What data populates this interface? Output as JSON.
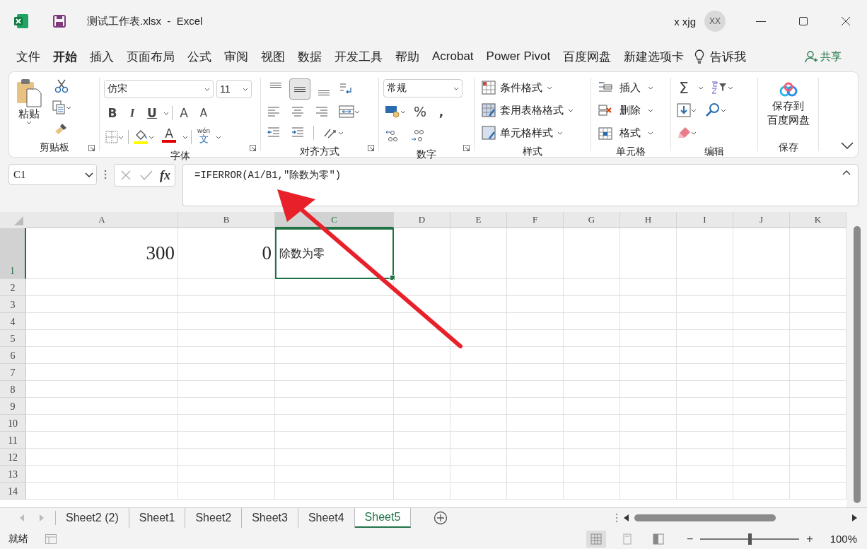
{
  "window": {
    "title": "测试工作表.xlsx  -  Excel",
    "user": "x xjg",
    "avatar": "XX"
  },
  "menu": [
    {
      "label": "文件",
      "selected": false
    },
    {
      "label": "开始",
      "selected": true
    },
    {
      "label": "插入",
      "selected": false
    },
    {
      "label": "页面布局",
      "selected": false
    },
    {
      "label": "公式",
      "selected": false
    },
    {
      "label": "审阅",
      "selected": false
    },
    {
      "label": "视图",
      "selected": false
    },
    {
      "label": "数据",
      "selected": false
    },
    {
      "label": "开发工具",
      "selected": false
    },
    {
      "label": "帮助",
      "selected": false
    },
    {
      "label": "Acrobat",
      "selected": false
    },
    {
      "label": "Power Pivot",
      "selected": false
    },
    {
      "label": "百度网盘",
      "selected": false
    },
    {
      "label": "新建选项卡",
      "selected": false
    }
  ],
  "tell_me": "告诉我",
  "share": "共享",
  "ribbon": {
    "groups": [
      {
        "kind": "clipboard",
        "label": "剪贴板",
        "launcher": true,
        "paste": "粘贴"
      },
      {
        "kind": "font",
        "label": "字体",
        "launcher": true,
        "font_name": "仿宋",
        "font_size": "11",
        "bold": "B",
        "italic": "I",
        "underline": "U",
        "grow": "A",
        "shrink": "A",
        "font_color": "A",
        "phonetic_top": "wén",
        "phonetic": "文"
      },
      {
        "kind": "alignment",
        "label": "对齐方式",
        "launcher": true,
        "vertical": [
          {
            "kind": "top",
            "selected": false
          },
          {
            "kind": "middle",
            "selected": true
          },
          {
            "kind": "bottom",
            "selected": false
          }
        ]
      },
      {
        "kind": "number",
        "label": "数字",
        "launcher": true,
        "format": "常规",
        "percent": "%",
        "comma": ","
      },
      {
        "kind": "styles",
        "label": "样式",
        "launcher": false,
        "commands": [
          "条件格式",
          "套用表格格式",
          "单元格样式"
        ]
      },
      {
        "kind": "cells",
        "label": "单元格",
        "launcher": false,
        "commands": [
          "插入",
          "删除",
          "格式"
        ]
      },
      {
        "kind": "editing",
        "label": "编辑",
        "launcher": false,
        "sum": "Σ"
      },
      {
        "kind": "save",
        "label": "保存",
        "launcher": false,
        "button": [
          "保存到",
          "百度网盘"
        ]
      }
    ]
  },
  "formula_bar": {
    "name_box": "C1",
    "fx": "fx",
    "formula": "=IFERROR(A1/B1,\"除数为零\")"
  },
  "columns": [
    {
      "label": "A",
      "selected": false
    },
    {
      "label": "B",
      "selected": false
    },
    {
      "label": "C",
      "selected": true
    },
    {
      "label": "D",
      "selected": false
    },
    {
      "label": "E",
      "selected": false
    },
    {
      "label": "F",
      "selected": false
    },
    {
      "label": "G",
      "selected": false
    },
    {
      "label": "H",
      "selected": false
    },
    {
      "label": "I",
      "selected": false
    },
    {
      "label": "J",
      "selected": false
    },
    {
      "label": "K",
      "selected": false
    }
  ],
  "rows": [
    {
      "header": "1",
      "selected": true,
      "cells": [
        "300",
        "0",
        "除数为零"
      ]
    },
    {
      "header": "2",
      "selected": false
    },
    {
      "header": "3",
      "selected": false
    },
    {
      "header": "4",
      "selected": false
    },
    {
      "header": "5",
      "selected": false
    },
    {
      "header": "6",
      "selected": false
    },
    {
      "header": "7",
      "selected": false
    },
    {
      "header": "8",
      "selected": false
    },
    {
      "header": "9",
      "selected": false
    },
    {
      "header": "10",
      "selected": false
    },
    {
      "header": "11",
      "selected": false
    },
    {
      "header": "12",
      "selected": false
    },
    {
      "header": "13",
      "selected": false
    },
    {
      "header": "14",
      "selected": false
    }
  ],
  "sheets": [
    {
      "label": "Sheet2 (2)",
      "selected": false
    },
    {
      "label": "Sheet1",
      "selected": false
    },
    {
      "label": "Sheet2",
      "selected": false
    },
    {
      "label": "Sheet3",
      "selected": false
    },
    {
      "label": "Sheet4",
      "selected": false
    },
    {
      "label": "Sheet5",
      "selected": true
    }
  ],
  "status_bar": {
    "status": "就绪",
    "views": [
      {
        "kind": "normal",
        "selected": true
      },
      {
        "kind": "page-layout",
        "selected": false
      },
      {
        "kind": "page-break",
        "selected": false
      }
    ],
    "zoom_out": "−",
    "zoom_in": "+",
    "zoom": {
      "level": 0.5
    },
    "zoom_text": "100%"
  }
}
